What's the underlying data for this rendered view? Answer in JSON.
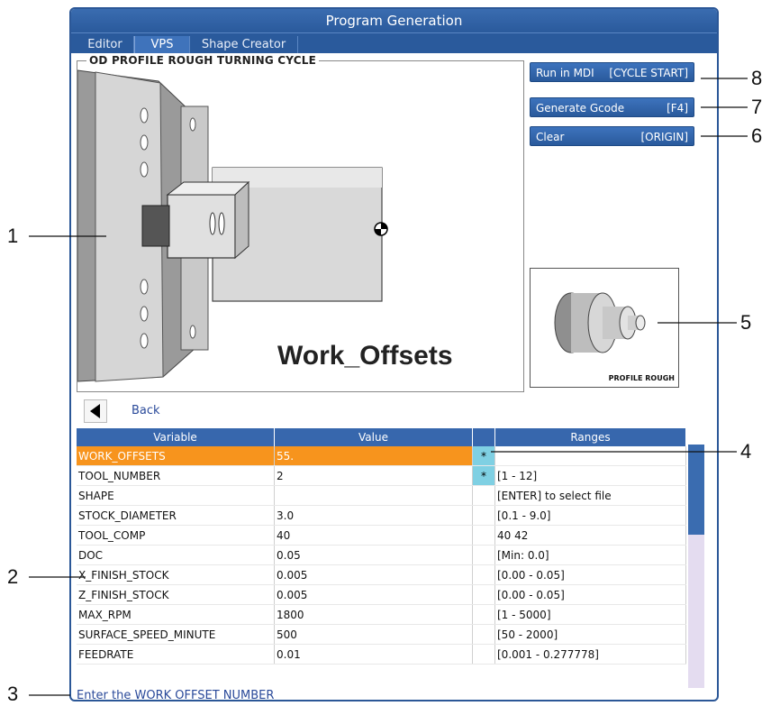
{
  "window": {
    "title": "Program Generation"
  },
  "tabs": [
    {
      "label": "Editor"
    },
    {
      "label": "VPS"
    },
    {
      "label": "Shape Creator"
    }
  ],
  "vps": {
    "cycle_title": "OD PROFILE ROUGH TURNING CYCLE",
    "image_caption": "Work_Offsets"
  },
  "buttons": {
    "run_mdi": {
      "label": "Run in MDI",
      "key": "[CYCLE START]"
    },
    "generate": {
      "label": "Generate Gcode",
      "key": "[F4]"
    },
    "clear": {
      "label": "Clear",
      "key": "[ORIGIN]"
    }
  },
  "preview": {
    "label": "PROFILE ROUGH"
  },
  "back": {
    "label": "Back"
  },
  "table": {
    "headers": [
      "Variable",
      "Value",
      "",
      "Ranges"
    ],
    "rows": [
      {
        "variable": "WORK_OFFSETS",
        "value": "55.",
        "flag": "*",
        "range": ""
      },
      {
        "variable": "TOOL_NUMBER",
        "value": "2",
        "flag": "*",
        "range": "[1 - 12]"
      },
      {
        "variable": "SHAPE",
        "value": "",
        "flag": "",
        "range": "[ENTER] to select file"
      },
      {
        "variable": "STOCK_DIAMETER",
        "value": "3.0",
        "flag": "",
        "range": "[0.1 - 9.0]"
      },
      {
        "variable": "TOOL_COMP",
        "value": "40",
        "flag": "",
        "range": "40 42"
      },
      {
        "variable": "DOC",
        "value": "0.05",
        "flag": "",
        "range": "[Min: 0.0]"
      },
      {
        "variable": "X_FINISH_STOCK",
        "value": "0.005",
        "flag": "",
        "range": "[0.00 - 0.05]"
      },
      {
        "variable": "Z_FINISH_STOCK",
        "value": "0.005",
        "flag": "",
        "range": "[0.00 - 0.05]"
      },
      {
        "variable": "MAX_RPM",
        "value": "1800",
        "flag": "",
        "range": "[1 - 5000]"
      },
      {
        "variable": "SURFACE_SPEED_MINUTE",
        "value": "500",
        "flag": "",
        "range": "[50 - 2000]"
      },
      {
        "variable": "FEEDRATE",
        "value": "0.01",
        "flag": "",
        "range": "[0.001 - 0.277778]"
      }
    ]
  },
  "status": {
    "text": "Enter the WORK OFFSET NUMBER"
  },
  "callouts": [
    "1",
    "2",
    "3",
    "4",
    "5",
    "6",
    "7",
    "8"
  ],
  "colors": {
    "accent": "#2a5a9c",
    "selected_row": "#f7941d",
    "flag_cell": "#7fd0e3"
  }
}
